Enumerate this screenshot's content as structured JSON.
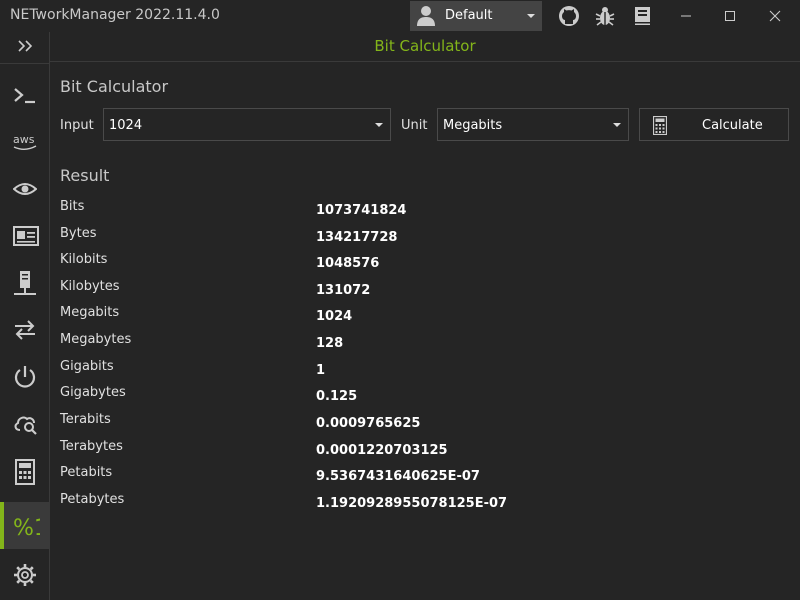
{
  "app": {
    "title": "NETworkManager 2022.11.4.0"
  },
  "profile": {
    "label": "Default"
  },
  "header": {
    "title": "Bit Calculator"
  },
  "sections": {
    "calculator": "Bit Calculator",
    "result": "Result"
  },
  "input": {
    "label": "Input",
    "value": "1024"
  },
  "unit": {
    "label": "Unit",
    "value": "Megabits"
  },
  "calculate": {
    "label": "Calculate"
  },
  "results": [
    {
      "name": "Bits",
      "value": "1073741824"
    },
    {
      "name": "Bytes",
      "value": "134217728"
    },
    {
      "name": "Kilobits",
      "value": "1048576"
    },
    {
      "name": "Kilobytes",
      "value": "131072"
    },
    {
      "name": "Megabits",
      "value": "1024"
    },
    {
      "name": "Megabytes",
      "value": "128"
    },
    {
      "name": "Gigabits",
      "value": "1"
    },
    {
      "name": "Gigabytes",
      "value": "0.125"
    },
    {
      "name": "Terabits",
      "value": "0.0009765625"
    },
    {
      "name": "Terabytes",
      "value": "0.0001220703125"
    },
    {
      "name": "Petabits",
      "value": "9.5367431640625E-07"
    },
    {
      "name": "Petabytes",
      "value": "1.1920928955078125E-07"
    }
  ],
  "sidebar": {
    "items": [
      {
        "icon": "powershell-icon"
      },
      {
        "icon": "aws-icon",
        "label": "aws"
      },
      {
        "icon": "eye-icon"
      },
      {
        "icon": "id-card-icon"
      },
      {
        "icon": "server-network-icon"
      },
      {
        "icon": "arrows-exchange-icon"
      },
      {
        "icon": "power-icon"
      },
      {
        "icon": "cloud-search-icon"
      },
      {
        "icon": "calculator-icon"
      },
      {
        "icon": "bit-calculator-icon",
        "label": "%1"
      },
      {
        "icon": "gear-icon"
      }
    ]
  },
  "colors": {
    "accent": "#83b51a",
    "background": "#252525",
    "panel": "#444444"
  }
}
